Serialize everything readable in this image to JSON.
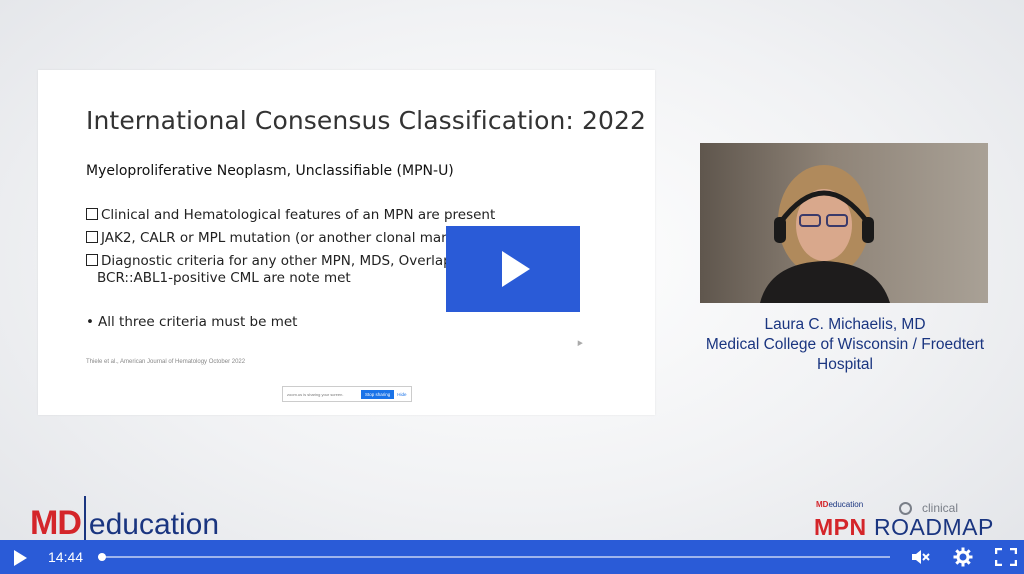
{
  "slide": {
    "title": "International Consensus Classification: 2022",
    "subtitle": "Myeloproliferative Neoplasm, Unclassifiable (MPN-U)",
    "criteria": [
      "Clinical and Hematological features of an MPN are present",
      "JAK2, CALR or MPL mutation (or another clonal marker) is present",
      "Diagnostic criteria for any other MPN, MDS, Overlap Syndrome or",
      "BCR::ABL1-positive CML are note met"
    ],
    "bullet": "All three criteria must be met",
    "citation": "Thiele et al., American Journal of Hematology October 2022",
    "share_bar": {
      "text": "zoom.us is sharing your screen.",
      "stop_label": "Stop sharing",
      "hide_label": "Hide"
    }
  },
  "speaker": {
    "name": "Laura C. Michaelis, MD",
    "affiliation_line1": "Medical College of Wisconsin / Froedtert",
    "affiliation_line2": "Hospital"
  },
  "branding": {
    "left_md": "MD",
    "left_education": "education",
    "mini_md": "MD",
    "mini_education": "education",
    "clinical": "clinical",
    "mpn": "MPN",
    "roadmap": "ROADMAP"
  },
  "player": {
    "time": "14:44",
    "progress": 0.003,
    "icons": [
      "play-icon",
      "mute-icon",
      "settings-icon",
      "fullscreen-icon"
    ]
  },
  "colors": {
    "accent": "#2a5bd7",
    "brand_red": "#d4252a",
    "brand_navy": "#1a3580"
  }
}
